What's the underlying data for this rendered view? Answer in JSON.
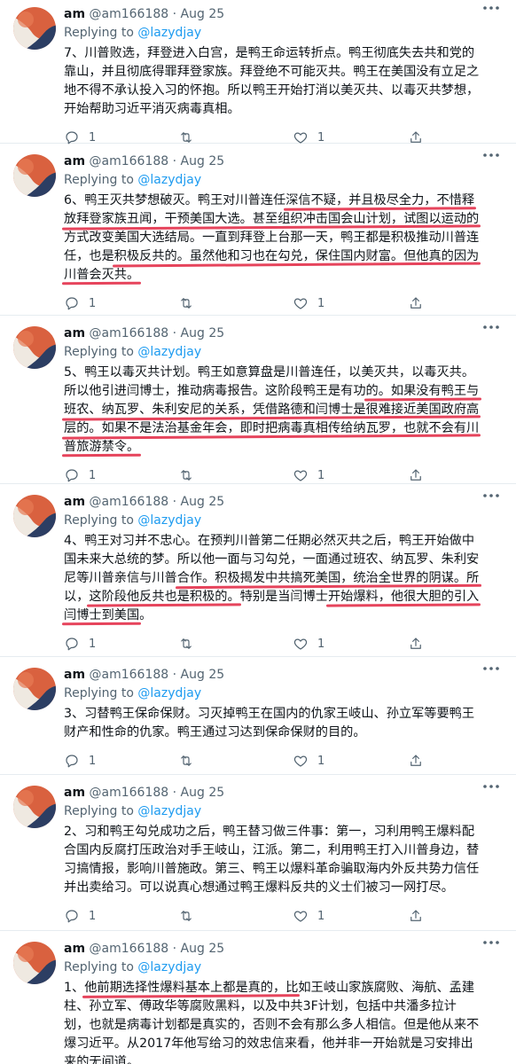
{
  "author": {
    "name": "am",
    "handle": "@am166188",
    "dot": "·"
  },
  "reply_prefix": "Replying to ",
  "reply_to": "@lazydjay",
  "tweets": [
    {
      "date": "Aug 25",
      "lines": [
        "7、川普败选，拜登进入白宫，是鸭王命运转折点。鸭王彻底失去共和党的",
        "靠山，并且彻底得罪拜登家族。拜登绝不可能灭共。鸭王在美国没有立足之",
        "地不得不承认投入习的怀抱。所以鸭王开始打消以美灭共、以毒灭共梦想，",
        "开始帮助习近平消灭病毒真相。"
      ],
      "reply_count": "1",
      "retweet_count": "",
      "like_count": "1"
    },
    {
      "date": "Aug 25",
      "lines": [
        "6、鸭王灭共梦想破灭。鸭王对川普连任深信不疑，并且极尽全力，不惜释",
        "放拜登家族丑闻，干预美国大选。甚至组织冲击国会山计划，试图以运动的",
        "方式改变美国大选结局。一直到拜登上台那一天，鸭王都是积极推动川普连",
        "任，也是积极反共的。虽然他和习也在勾兑，保住国内财富。但他真的因为",
        "川普会灭共。"
      ],
      "reply_count": "1",
      "retweet_count": "",
      "like_count": "1"
    },
    {
      "date": "Aug 25",
      "lines": [
        "5、鸭王以毒灭共计划。鸭王如意算盘是川普连任，以美灭共，以毒灭共。",
        "所以他引进闫博士，推动病毒报告。这阶段鸭王是有功的。如果没有鸭王与",
        "班农、纳瓦罗、朱利安尼的关系，凭借路德和闫博士是很难接近美国政府高",
        "层的。如果不是法治基金年会，即时把病毒真相传给纳瓦罗，也就不会有川",
        "普旅游禁令。"
      ],
      "reply_count": "1",
      "retweet_count": "",
      "like_count": "1"
    },
    {
      "date": "Aug 25",
      "lines": [
        "4、鸭王对习并不忠心。在预判川普第二任期必然灭共之后，鸭王开始做中",
        "国未来大总统的梦。所以他一面与习勾兑，一面通过班农、纳瓦罗、朱利安",
        "尼等川普亲信与川普合作。积极揭发中共搞死美国，统治全世界的阴谋。所",
        "以，这阶段他反共也是积极的。特别是当闫博士开始爆料，他很大胆的引入",
        "闫博士到美国。"
      ],
      "reply_count": "1",
      "retweet_count": "",
      "like_count": "1"
    },
    {
      "date": "Aug 25",
      "lines": [
        "3、习替鸭王保命保财。习灭掉鸭王在国内的仇家王岐山、孙立军等要鸭王",
        "财产和性命的仇家。鸭王通过习达到保命保财的目的。"
      ],
      "reply_count": "1",
      "retweet_count": "",
      "like_count": "1"
    },
    {
      "date": "Aug 25",
      "lines": [
        "2、习和鸭王勾兑成功之后，鸭王替习做三件事：第一，习利用鸭王爆料配",
        "合国内反腐打压政治对手王岐山，江派。第二，利用鸭王打入川普身边，替",
        "习搞情报，影响川普施政。第三、鸭王以爆料革命骗取海内外反共势力信任",
        "并出卖给习。可以说真心想通过鸭王爆料反共的义士们被习一网打尽。"
      ],
      "reply_count": "1",
      "retweet_count": "",
      "like_count": "1"
    },
    {
      "date": "Aug 25",
      "lines": [
        "1、他前期选择性爆料基本上都是真的，比如王岐山家族腐败、海航、孟建",
        "柱、孙立军、傅政华等腐败黑料，以及中共3F计划，包括中共潘多拉计",
        "划，也就是病毒计划都是真实的，否则不会有那么多人相信。但是他从来不",
        "爆习近平。从2017年他写给习的效忠信来看，他并非一开始就是习安排出",
        "来的无间道。"
      ],
      "reply_count": "",
      "retweet_count": "",
      "like_count": ""
    }
  ],
  "icons": [
    "more-icon",
    "reply-icon",
    "retweet-icon",
    "like-icon",
    "share-icon"
  ],
  "colors": {
    "accent": "#1d9bf0",
    "underline": "#e2233f",
    "muted": "#536471"
  }
}
